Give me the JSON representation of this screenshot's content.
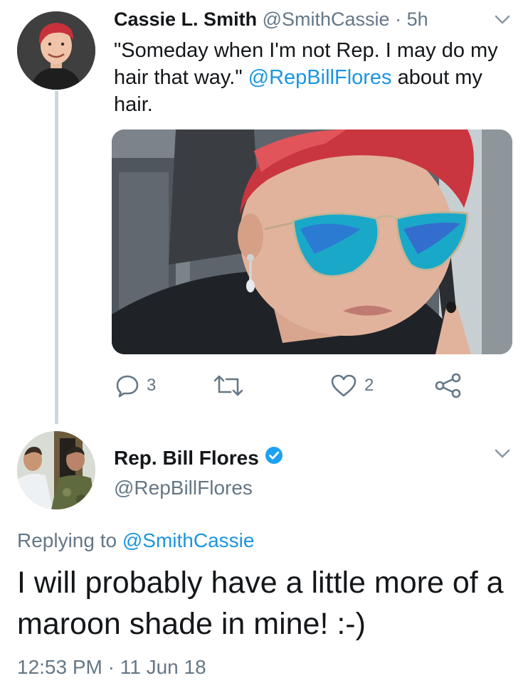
{
  "tweet1": {
    "author_name": "Cassie L. Smith",
    "author_handle": "@SmithCassie",
    "separator": " · ",
    "time_ago": "5h",
    "text_before": "\"Someday when I'm not Rep. I may do my hair that way.\" ",
    "mention": "@RepBillFlores",
    "text_after": " about my hair.",
    "replies": "3",
    "retweets": "",
    "likes": "2"
  },
  "tweet2": {
    "author_name": "Rep. Bill Flores",
    "author_handle": "@RepBillFlores",
    "verified": true,
    "replying_label": "Replying to ",
    "replying_handle": "@SmithCassie",
    "text": "I will probably have a little more of a maroon shade in mine!  :-)",
    "timestamp": "12:53 PM · 11 Jun 18"
  },
  "icons": {
    "reply": "reply-icon",
    "retweet": "retweet-icon",
    "like": "heart-icon",
    "share": "share-icon",
    "more": "chevron-down-icon",
    "verified": "verified-badge-icon"
  },
  "colors": {
    "link": "#1b95e0",
    "muted": "#657786",
    "thread_line": "#ccd6dd",
    "verified": "#1da1f2"
  }
}
